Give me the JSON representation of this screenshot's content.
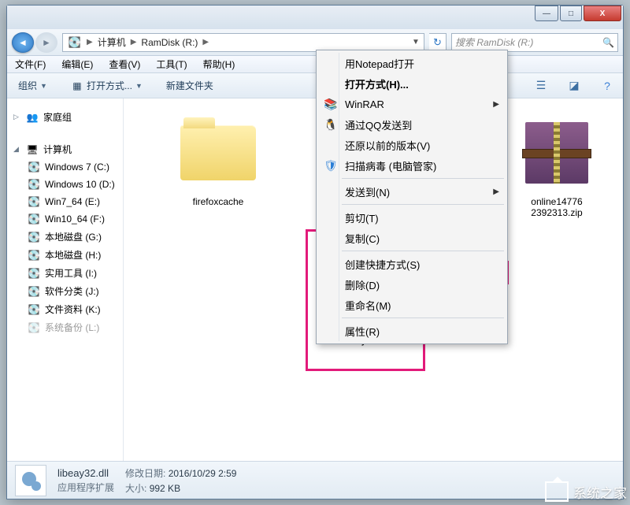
{
  "title_buttons": {
    "min": "—",
    "max": "□",
    "close": "X"
  },
  "breadcrumb": {
    "root": "计算机",
    "loc": "RamDisk (R:)"
  },
  "search_placeholder": "搜索 RamDisk (R:)",
  "menubar": [
    "文件(F)",
    "编辑(E)",
    "查看(V)",
    "工具(T)",
    "帮助(H)"
  ],
  "toolbar": {
    "organize": "组织",
    "openwith": "打开方式...",
    "newfolder": "新建文件夹"
  },
  "sidebar": {
    "homegroup": "家庭组",
    "computer": "计算机",
    "drives": [
      "Windows 7 (C:)",
      "Windows 10 (D:)",
      "Win7_64 (E:)",
      "Win10_64 (F:)",
      "本地磁盘 (G:)",
      "本地磁盘 (H:)",
      "实用工具 (I:)",
      "软件分类 (J:)",
      "文件资料 (K:)",
      "系统备份 (L:)"
    ]
  },
  "files": {
    "folder": "firefoxcache",
    "zip_line1": "online14776",
    "zip_line2": "2392313.zip",
    "selected": "libeay32.dll"
  },
  "context": {
    "notepad": "用Notepad打开",
    "openwith": "打开方式(H)...",
    "winrar": "WinRAR",
    "qq": "通过QQ发送到",
    "restore": "还原以前的版本(V)",
    "scan": "扫描病毒 (电脑管家)",
    "sendto": "发送到(N)",
    "cut": "剪切(T)",
    "copy": "复制(C)",
    "shortcut": "创建快捷方式(S)",
    "delete": "删除(D)",
    "rename": "重命名(M)",
    "props": "属性(R)"
  },
  "status": {
    "name": "libeay32.dll",
    "type": "应用程序扩展",
    "mod_label": "修改日期:",
    "mod_val": "2016/10/29 2:59",
    "size_label": "大小:",
    "size_val": "992 KB"
  },
  "watermark": "系统之家"
}
